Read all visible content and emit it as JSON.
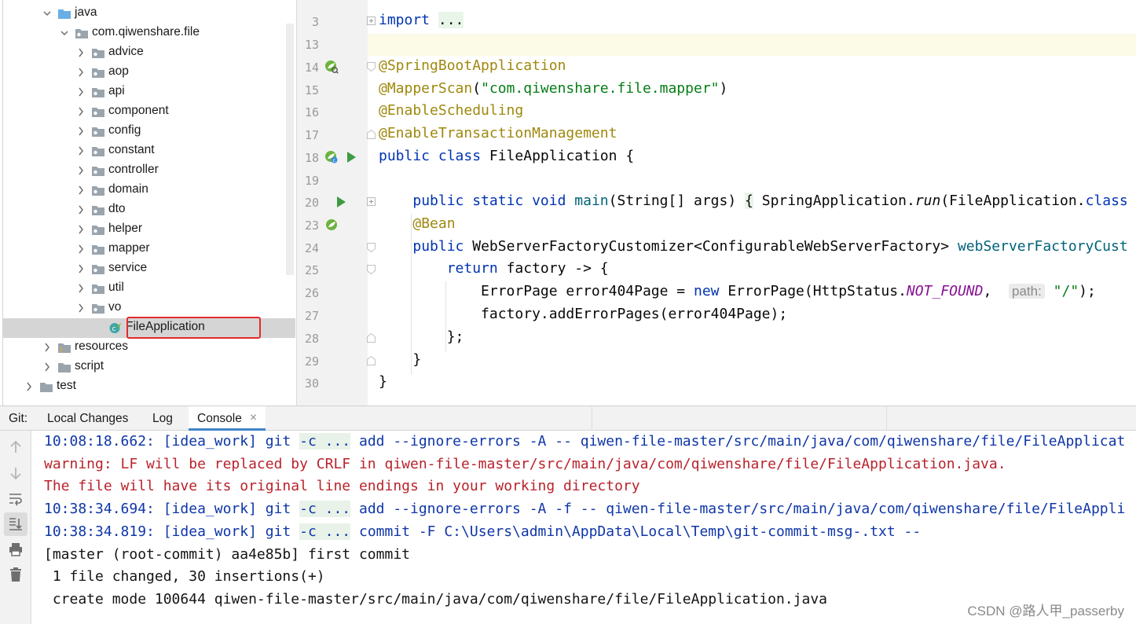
{
  "project_tree": {
    "rows": [
      {
        "label": "java",
        "icon": "folder-blue-icon",
        "chevron": "down"
      },
      {
        "label": "com.qiwenshare.file",
        "icon": "package-icon",
        "chevron": "down"
      },
      {
        "label": "advice",
        "icon": "package-icon",
        "chevron": "right"
      },
      {
        "label": "aop",
        "icon": "package-icon",
        "chevron": "right"
      },
      {
        "label": "api",
        "icon": "package-icon",
        "chevron": "right"
      },
      {
        "label": "component",
        "icon": "package-icon",
        "chevron": "right"
      },
      {
        "label": "config",
        "icon": "package-icon",
        "chevron": "right"
      },
      {
        "label": "constant",
        "icon": "package-icon",
        "chevron": "right"
      },
      {
        "label": "controller",
        "icon": "package-icon",
        "chevron": "right"
      },
      {
        "label": "domain",
        "icon": "package-icon",
        "chevron": "right"
      },
      {
        "label": "dto",
        "icon": "package-icon",
        "chevron": "right"
      },
      {
        "label": "helper",
        "icon": "package-icon",
        "chevron": "right"
      },
      {
        "label": "mapper",
        "icon": "package-icon",
        "chevron": "right"
      },
      {
        "label": "service",
        "icon": "package-icon",
        "chevron": "right"
      },
      {
        "label": "util",
        "icon": "package-icon",
        "chevron": "right"
      },
      {
        "label": "vo",
        "icon": "package-icon",
        "chevron": "right"
      },
      {
        "label": "FileApplication",
        "icon": "spring-boot-class-icon",
        "chevron": "none",
        "selected": true
      },
      {
        "label": "resources",
        "icon": "resources-folder-icon",
        "chevron": "right"
      },
      {
        "label": "script",
        "icon": "folder-icon",
        "chevron": "right"
      },
      {
        "label": "test",
        "icon": "folder-icon",
        "chevron": "right"
      }
    ]
  },
  "editor": {
    "line_numbers": [
      "3",
      "13",
      "14",
      "15",
      "16",
      "17",
      "18",
      "19",
      "20",
      "23",
      "24",
      "25",
      "26",
      "27",
      "28",
      "29",
      "30"
    ],
    "l3": {
      "kw": "import",
      "fold": "..."
    },
    "l14": {
      "text": "@SpringBootApplication"
    },
    "l15": {
      "ann": "@MapperScan",
      "open": "(",
      "str": "\"com.qiwenshare.file.mapper\"",
      "close": ")"
    },
    "l16": {
      "text": "@EnableScheduling"
    },
    "l17": {
      "text": "@EnableTransactionManagement"
    },
    "l18": {
      "kw1": "public",
      "kw2": "class",
      "name": "FileApplication",
      "brace": "{"
    },
    "l20": {
      "kw": "public static void",
      "fn": "main",
      "params": "(String[] args)",
      "fold": "{",
      "call_pre": "SpringApplication.",
      "call_fn": "run",
      "call_args": "(FileApplication.",
      "call_kw": "class"
    },
    "l23": {
      "text": "@Bean"
    },
    "l24": {
      "kw": "public",
      "type": "WebServerFactoryCustomizer<ConfigurableWebServerFactory>",
      "fn": "webServerFactoryCust"
    },
    "l25": {
      "kw": "return",
      "rest": "factory -> {"
    },
    "l26": {
      "pre": "ErrorPage error404Page = ",
      "kw": "new",
      "mid": "ErrorPage(HttpStatus.",
      "cst": "NOT_FOUND",
      "comma": ",",
      "hint": "path:",
      "str": "\"/\"",
      "end": ");"
    },
    "l27": {
      "text": "factory.addErrorPages(error404Page);"
    },
    "l28": {
      "text": "};"
    },
    "l29": {
      "text": "}"
    },
    "l30": {
      "text": "}"
    }
  },
  "git": {
    "label": "Git:",
    "tabs": [
      "Local Changes",
      "Log",
      "Console"
    ],
    "active_tab": "Console",
    "close_glyph": "×",
    "console": {
      "l1": {
        "ts": "10:08:18.662: [idea_work] git ",
        "flag": "-c ...",
        "rest": " add --ignore-errors -A -- qiwen-file-master/src/main/java/com/qiwenshare/file/FileApplicat"
      },
      "l2": "warning: LF will be replaced by CRLF in qiwen-file-master/src/main/java/com/qiwenshare/file/FileApplication.java.",
      "l3": "The file will have its original line endings in your working directory",
      "l4": {
        "ts": "10:38:34.694: [idea_work] git ",
        "flag": "-c ...",
        "rest": " add --ignore-errors -A -f -- qiwen-file-master/src/main/java/com/qiwenshare/file/FileAppli"
      },
      "l5": {
        "ts": "10:38:34.819: [idea_work] git ",
        "flag": "-c ...",
        "rest": " commit -F C:\\Users\\admin\\AppData\\Local\\Temp\\git-commit-msg-.txt --"
      },
      "l6": "[master (root-commit) aa4e85b] first commit",
      "l7": " 1 file changed, 30 insertions(+)",
      "l8": " create mode 100644 qiwen-file-master/src/main/java/com/qiwenshare/file/FileApplication.java"
    }
  },
  "watermark": "CSDN @路人甲_passerby"
}
